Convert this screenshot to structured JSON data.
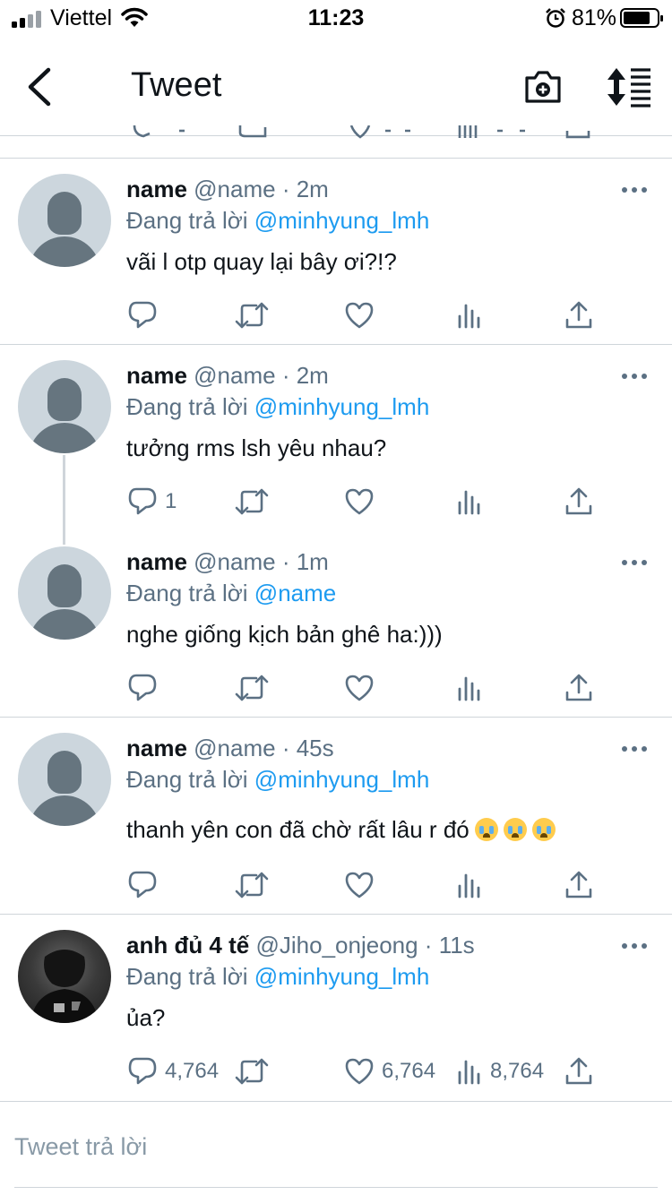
{
  "status": {
    "carrier": "Viettel",
    "time": "11:23",
    "battery_pct": "81%",
    "battery_level": 0.81
  },
  "header": {
    "title": "Tweet"
  },
  "tweets": [
    {
      "name": "name",
      "handle": "@name",
      "time": "2m",
      "replying": "Đang trả lời",
      "mention": "@minhyung_lmh",
      "text": "vãi l otp quay lại bây ơi?!?",
      "reply_count": "",
      "retweet_count": "",
      "like_count": "",
      "views_count": ""
    },
    {
      "name": "name",
      "handle": "@name",
      "time": "2m",
      "replying": "Đang trả lời",
      "mention": "@minhyung_lmh",
      "text": "tưởng rms lsh yêu nhau?",
      "reply_count": "1",
      "retweet_count": "",
      "like_count": "",
      "views_count": ""
    },
    {
      "name": "name",
      "handle": "@name",
      "time": "1m",
      "replying": "Đang trả lời",
      "mention": "@name",
      "text": "nghe giống kịch bản ghê ha:)))",
      "reply_count": "",
      "retweet_count": "",
      "like_count": "",
      "views_count": ""
    },
    {
      "name": "name",
      "handle": "@name",
      "time": "45s",
      "replying": "Đang trả lời",
      "mention": "@minhyung_lmh",
      "text": "thanh yên con đã chờ rất lâu r đó",
      "emoji": [
        "loudly-crying-face",
        "loudly-crying-face",
        "loudly-crying-face"
      ],
      "reply_count": "",
      "retweet_count": "",
      "like_count": "",
      "views_count": ""
    },
    {
      "name": "anh đủ 4 tế",
      "handle": "@Jiho_onjeong",
      "time": "11s",
      "replying": "Đang trả lời",
      "mention": "@minhyung_lmh",
      "text": "ủa?",
      "reply_count": "4,764",
      "retweet_count": "",
      "like_count": "6,764",
      "views_count": "8,764"
    }
  ],
  "composer": {
    "placeholder": "Tweet trả lời"
  },
  "icons": [
    "signal-icon",
    "wifi-icon",
    "alarm-icon",
    "battery-icon",
    "back-icon",
    "camera-icon",
    "sort-icon",
    "more-icon",
    "reply-icon",
    "retweet-icon",
    "like-icon",
    "views-icon",
    "share-icon"
  ],
  "colors": {
    "accent": "#1d9bf0",
    "secondary_text": "#5b7083",
    "separator": "#cfd5da",
    "avatar_bg": "#ccd6dd",
    "avatar_fg": "#66757f"
  }
}
